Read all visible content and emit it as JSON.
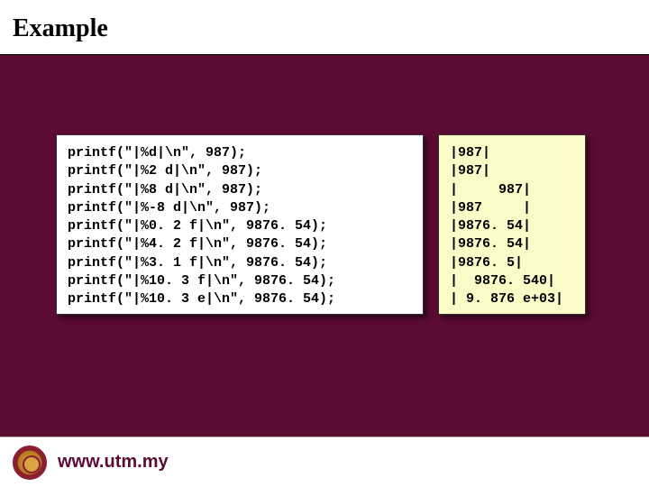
{
  "header": {
    "title": "Example"
  },
  "code": {
    "lines": [
      "printf(\"|%d|\\n\", 987);",
      "printf(\"|%2 d|\\n\", 987);",
      "printf(\"|%8 d|\\n\", 987);",
      "printf(\"|%-8 d|\\n\", 987);",
      "printf(\"|%0. 2 f|\\n\", 9876. 54);",
      "printf(\"|%4. 2 f|\\n\", 9876. 54);",
      "printf(\"|%3. 1 f|\\n\", 9876. 54);",
      "printf(\"|%10. 3 f|\\n\", 9876. 54);",
      "printf(\"|%10. 3 e|\\n\", 9876. 54);"
    ]
  },
  "output": {
    "lines": [
      "|987|",
      "|987|",
      "|     987|",
      "|987     |",
      "|9876. 54|",
      "|9876. 54|",
      "|9876. 5|",
      "|  9876. 540|",
      "| 9. 876 e+03|"
    ]
  },
  "footer": {
    "url": "www.utm.my",
    "logo_name": "utm-crest"
  }
}
